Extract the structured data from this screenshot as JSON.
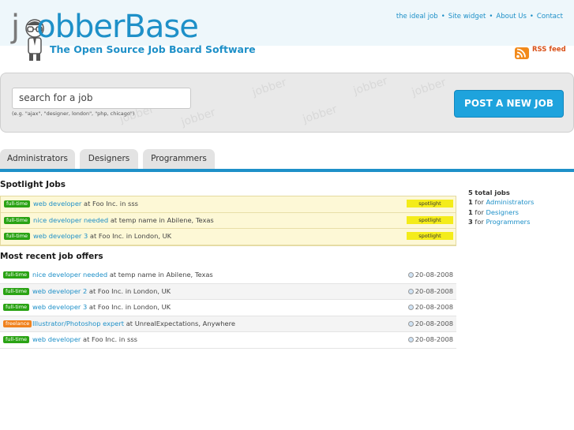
{
  "logo": {
    "prefix": "j",
    "word": "obberBase",
    "tagline": "The Open Source Job Board Software"
  },
  "topnav": [
    "the ideal job",
    "Site widget",
    "About Us",
    "Contact"
  ],
  "rss": {
    "label": "RSS feed",
    "icon": "rss-icon"
  },
  "watermark_text": "jobber",
  "search": {
    "value": "search for a job",
    "hint": "(e.g. \"ajax\", \"designer, london\", \"php, chicago\")"
  },
  "post_button": "POST A NEW JOB",
  "tabs": [
    "Administrators",
    "Designers",
    "Programmers"
  ],
  "spotlight": {
    "title": "Spotlight Jobs",
    "rows": [
      {
        "type": "full-time",
        "title": "web developer",
        "company": "Foo Inc.",
        "location": "sss",
        "tag": "spotlight"
      },
      {
        "type": "full-time",
        "title": "nice developer needed",
        "company": "temp name",
        "location": "Abilene, Texas",
        "tag": "spotlight"
      },
      {
        "type": "full-time",
        "title": "web developer 3",
        "company": "Foo Inc.",
        "location": "London, UK",
        "tag": "spotlight"
      }
    ]
  },
  "recent": {
    "title": "Most recent job offers",
    "rows": [
      {
        "type": "full-time",
        "title": "nice developer needed",
        "company": "temp name",
        "location": "Abilene, Texas",
        "date": "20-08-2008"
      },
      {
        "type": "full-time",
        "title": "web developer 2",
        "company": "Foo Inc.",
        "location": "London, UK",
        "date": "20-08-2008"
      },
      {
        "type": "full-time",
        "title": "web developer 3",
        "company": "Foo Inc.",
        "location": "London, UK",
        "date": "20-08-2008"
      },
      {
        "type": "freelance",
        "title": "Illustrator/Photoshop expert",
        "company": "UnrealExpectations",
        "location": "Anywhere",
        "date": "20-08-2008"
      },
      {
        "type": "full-time",
        "title": "web developer",
        "company": "Foo Inc.",
        "location": "sss",
        "date": "20-08-2008"
      }
    ]
  },
  "words": {
    "at": "at",
    "in": "in",
    "comma": ",",
    "for": "for"
  },
  "sidebar": {
    "total_count": "5",
    "total_label": "total jobs",
    "items": [
      {
        "count": "1",
        "label": "Administrators"
      },
      {
        "count": "1",
        "label": "Designers"
      },
      {
        "count": "3",
        "label": "Programmers"
      }
    ]
  },
  "colors": {
    "accent": "#1e90c8",
    "fulltime": "#2aa314",
    "freelance": "#f0821e",
    "spotlight": "#f4ec1a",
    "post_button": "#1ea3dd"
  }
}
